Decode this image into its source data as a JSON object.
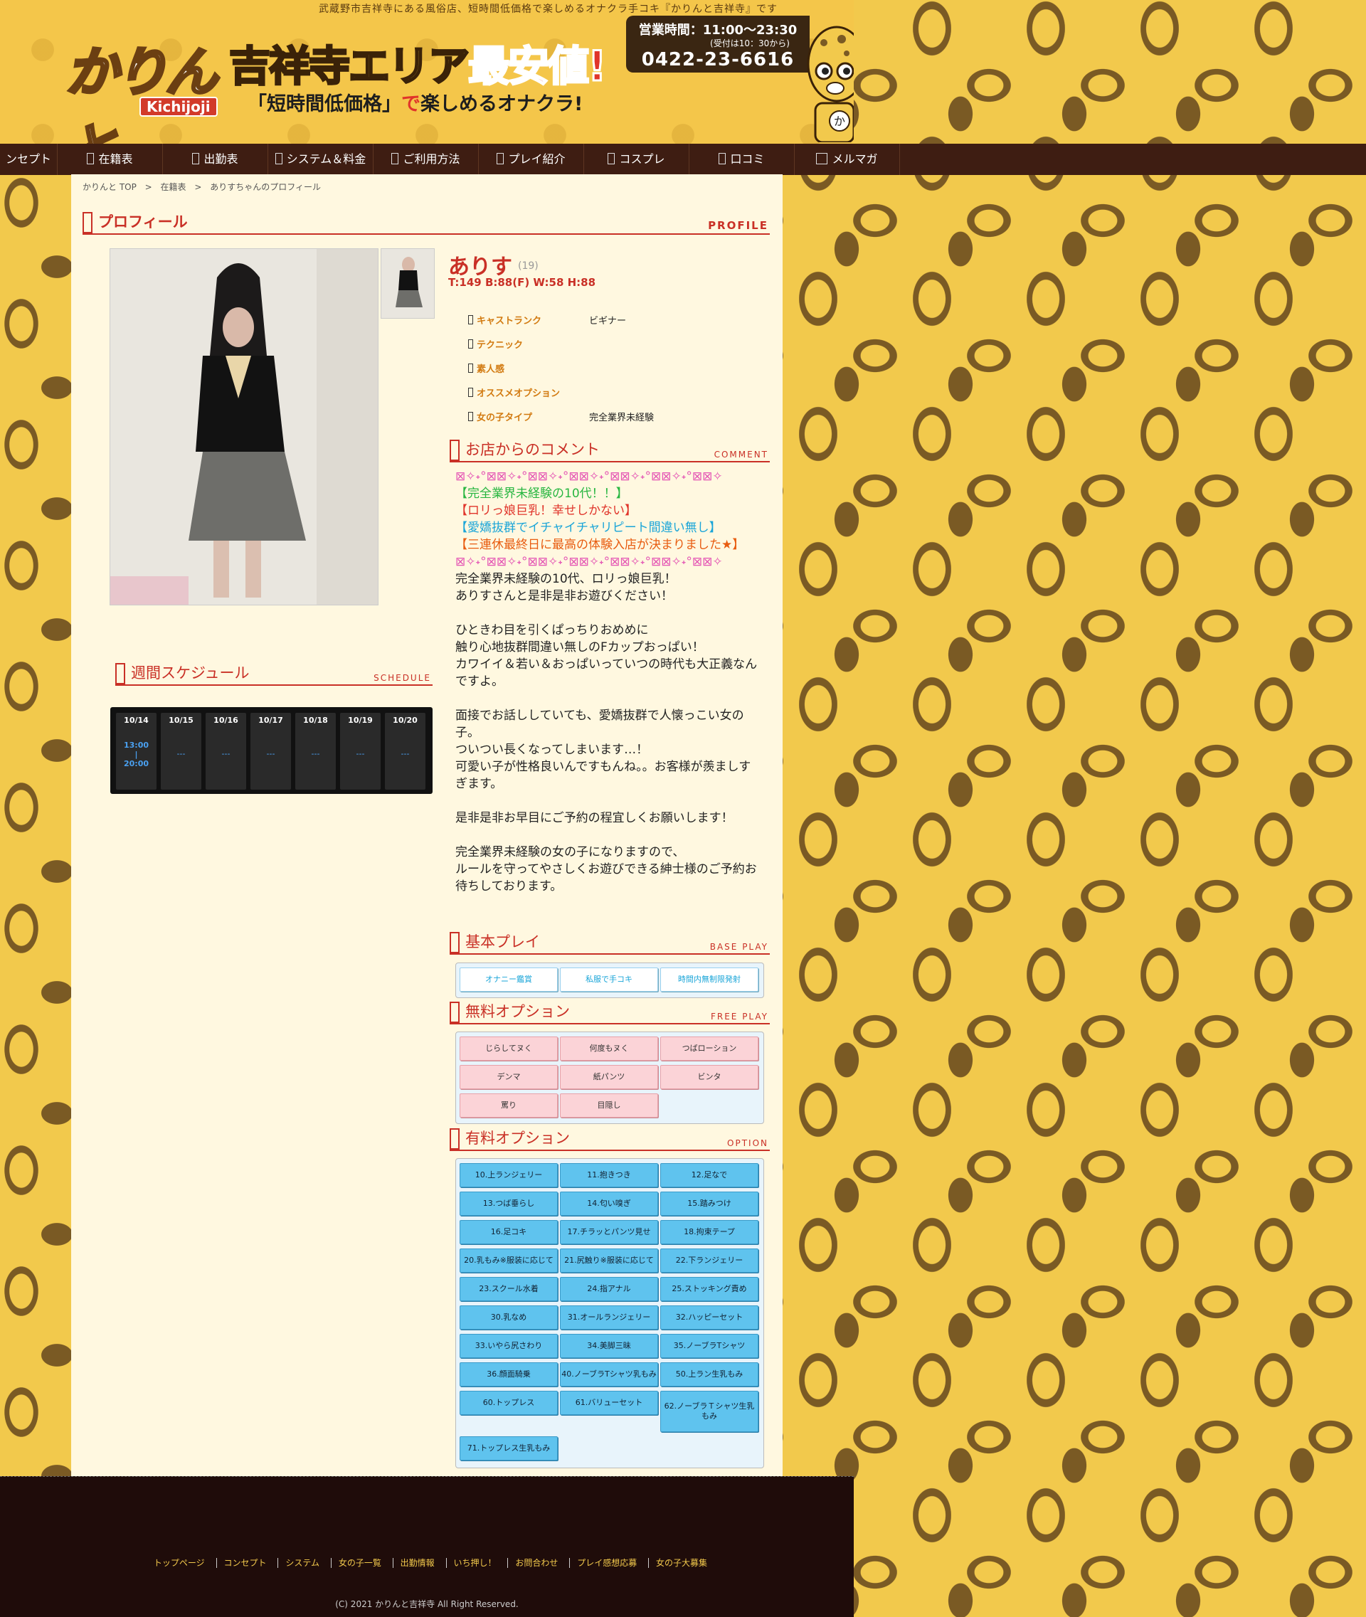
{
  "header": {
    "tagline": "武蔵野市吉祥寺にある風俗店、短時間低価格で楽しめるオナクラ手コキ『かりんと吉祥寺』です",
    "logo_text": "かりんと",
    "logo_sub": "Kichijoji",
    "catch_a": "吉祥寺エリア",
    "catch_b": "最安値!",
    "catch_sub_a": "「短時間低価格」",
    "catch_sub_b": "で",
    "catch_sub_c": "楽しめるオナクラ!",
    "hours_label": "営業時間：11:00〜23:30",
    "hours_note": "(受付は10：30から)",
    "phone": "0422-23-6616",
    "mascot_label": "か"
  },
  "nav": [
    {
      "label": "ンセプト"
    },
    {
      "label": "在籍表"
    },
    {
      "label": "出勤表"
    },
    {
      "label": "システム＆料金"
    },
    {
      "label": "ご利用方法"
    },
    {
      "label": "プレイ紹介"
    },
    {
      "label": "コスプレ"
    },
    {
      "label": "口コミ"
    },
    {
      "label": "メルマガ"
    }
  ],
  "breadcrumb": [
    "かりんと TOP",
    ">",
    "在籍表",
    ">",
    "ありすちゃんのプロフィール"
  ],
  "profile": {
    "title_jp": "プロフィール",
    "title_en": "PROFILE",
    "name": "ありす",
    "age": "(19)",
    "size": "T:149 B:88(F) W:58 H:88",
    "attributes": [
      {
        "label": "キャストランク",
        "value": "ビギナー"
      },
      {
        "label": "テクニック",
        "value": ""
      },
      {
        "label": "素人感",
        "value": ""
      },
      {
        "label": "オススメオプション",
        "value": ""
      },
      {
        "label": "女の子タイプ",
        "value": "完全業界未経験"
      }
    ]
  },
  "comment": {
    "title_jp": "お店からのコメント",
    "title_en": "COMMENT",
    "deco": "⊠✧˖°⊠⊠✧˖°⊠⊠✧˖°⊠⊠✧˖°⊠⊠✧˖°⊠⊠✧˖°⊠⊠✧",
    "h1": "【完全業界未経験の10代！！】",
    "h2": "【ロリっ娘巨乳！幸せしかない】",
    "h3": "【愛嬌抜群でイチャイチャリピート間違い無し】",
    "h4": "【三連休最終日に最高の体験入店が決まりました★】",
    "p1": "完全業界未経験の10代、ロリっ娘巨乳！",
    "p2": "ありすさんと是非是非お遊びください！",
    "p3": "ひときわ目を引くぱっちりおめめに",
    "p4": "触り心地抜群間違い無しのFカップおっぱい！",
    "p5": "カワイイ＆若い＆おっぱいっていつの時代も大正義なんですよ。",
    "p6": "面接でお話ししていても、愛嬌抜群で人懐っこい女の子。",
    "p7": "ついつい長くなってしまいます…！",
    "p8": "可愛い子が性格良いんですもんね。。お客様が羨ましすぎます。",
    "p9": "是非是非お早目にご予約の程宜しくお願いします！",
    "p10": "完全業界未経験の女の子になりますので、",
    "p11": "ルールを守ってやさしくお遊びできる紳士様のご予約お待ちしております。"
  },
  "schedule": {
    "title_jp": "週間スケジュール",
    "title_en": "SCHEDULE",
    "days": [
      {
        "date": "10/14",
        "start": "13:00",
        "sep": "|",
        "end": "20:00"
      },
      {
        "date": "10/15",
        "value": "---"
      },
      {
        "date": "10/16",
        "value": "---"
      },
      {
        "date": "10/17",
        "value": "---"
      },
      {
        "date": "10/18",
        "value": "---"
      },
      {
        "date": "10/19",
        "value": "---"
      },
      {
        "date": "10/20",
        "value": "---"
      }
    ]
  },
  "base_play": {
    "title_jp": "基本プレイ",
    "title_en": "BASE PLAY",
    "items": [
      "オナニー鑑賞",
      "私服で手コキ",
      "時間内無制限発射"
    ]
  },
  "free_play": {
    "title_jp": "無料オプション",
    "title_en": "FREE PLAY",
    "items": [
      "じらしてヌく",
      "何度もヌく",
      "つばローション",
      "デンマ",
      "紙パンツ",
      "ビンタ",
      "罵り",
      "目隠し"
    ]
  },
  "paid_option": {
    "title_jp": "有料オプション",
    "title_en": "OPTION",
    "items": [
      "10.上ランジェリー",
      "11.抱きつき",
      "12.足なで",
      "13.つば垂らし",
      "14.匂い嗅ぎ",
      "15.踏みつけ",
      "16.足コキ",
      "17.チラッとパンツ見せ",
      "18.拘束テープ",
      "20.乳もみ※服装に応じて",
      "21.尻触り※服装に応じて",
      "22.下ランジェリー",
      "23.スクール水着",
      "24.指アナル",
      "25.ストッキング責め",
      "30.乳なめ",
      "31.オールランジェリー",
      "32.ハッピーセット",
      "33.いやら尻さわり",
      "34.美脚三昧",
      "35.ノーブラTシャツ",
      "36.顔面騎乗",
      "40.ノーブラTシャツ乳もみ",
      "50.上ラン生乳もみ",
      "60.トップレス",
      "61.バリューセット",
      "62.ノーブラＴシャツ生乳もみ",
      "71.トップレス生乳もみ"
    ]
  },
  "footer": {
    "links": [
      "トップページ",
      "コンセプト",
      "システム",
      "女の子一覧",
      "出勤情報",
      "いち押し！",
      "お問合わせ",
      "プレイ感想応募",
      "女の子大募集"
    ],
    "copyright": "(C) 2021 かりんと吉祥寺 All Right Reserved."
  },
  "colors": {
    "accent": "#c93026",
    "nav_bg": "#3e1d12",
    "page_bg": "#fff8e0",
    "leopard": "#f2c94c"
  }
}
